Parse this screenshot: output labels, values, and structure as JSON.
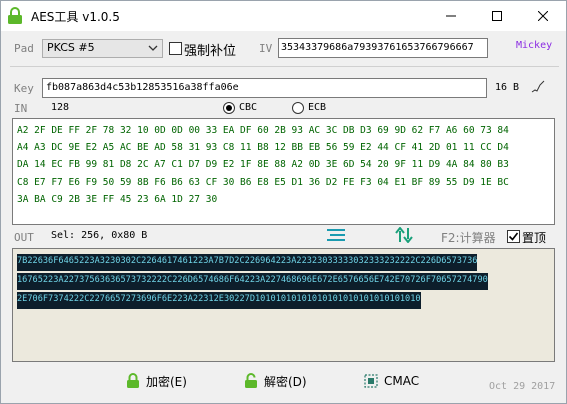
{
  "window": {
    "title": "AES工具 v1.0.5"
  },
  "labels": {
    "pad": "Pad",
    "iv": "IV",
    "key": "Key",
    "in": "IN",
    "out": "OUT"
  },
  "pad_select": {
    "value": "PKCS #5"
  },
  "force_pad": {
    "label": "强制补位",
    "checked": false
  },
  "iv_input": {
    "value": "35343379686a79393761653766796667"
  },
  "author": "Mickey",
  "key_input": {
    "value": "fb087a863d4c53b12853516a38ffa06e"
  },
  "key_length": "16 B",
  "in_length": "128",
  "mode": {
    "cbc_label": "CBC",
    "ecb_label": "ECB",
    "selected": "CBC"
  },
  "input_text": [
    "A2 2F DE FF 2F 78 32 10 0D 0D 00 33 EA DF 60 2B 93 AC 3C DB D3 69 9D 62 F7 A6 60 73 84",
    "A4 A3 DC 9E E2 A5 AC BE AD 58 31 93 C8 11 B8 12 BB EB 56 59 E2 44 CF 41 2D 01 11 CC D4",
    "DA 14 EC FB 99 81 D8 2C A7 C1 D7 D9 E2 1F 8E 88 A2 0D 3E 6D 54 20 9F 11 D9 4A 84 80 B3",
    "C8 E7 F7 E6 F9 50 59 8B F6 B6 63 CF 30 B6 E8 E5 D1 36 D2 FE F3 04 E1 BF 89 55 D9 1E BC",
    "3A BA C9 2B 3E FF 45 23 6A 1D 27 30"
  ],
  "selection": "Sel: 256, 0x80 B",
  "calculator_label": "F2:计算器",
  "pin_top": {
    "label": "置顶",
    "checked": true
  },
  "output_text": [
    "7B22636F6465223A3230302C2264617461223A7B7D2C226964223A22323033333032333232222C226D6573736",
    "16765223A22737563636573732222C226D6574686F64223A227468696E672E6576656E742E70726F70657274790",
    "2E706F7374222C2276657273696F6E223A22312E30227D10101010101010101010101010101010"
  ],
  "buttons": {
    "encrypt": "加密(E)",
    "decrypt": "解密(D)",
    "cmac": "CMAC"
  },
  "date": "Oct 29 2017",
  "colors": {
    "input_text": "#006400",
    "output_bg": "#0d1e2b",
    "output_text": "#6fd3e6",
    "author": "#8a2be2",
    "lock_icon": "#5cb82a"
  }
}
